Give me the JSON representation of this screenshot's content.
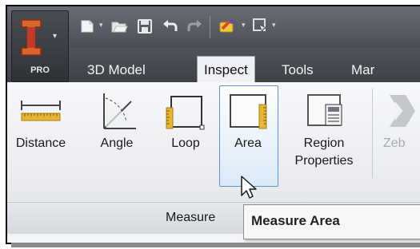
{
  "app": {
    "badge": "PRO"
  },
  "tabs": [
    {
      "label": "3D Model"
    },
    {
      "label": "Inspect",
      "active": true
    },
    {
      "label": "Tools"
    },
    {
      "label": "Mar"
    }
  ],
  "tools": [
    {
      "label": "Distance",
      "icon": "distance-icon"
    },
    {
      "label": "Angle",
      "icon": "angle-icon"
    },
    {
      "label": "Loop",
      "icon": "loop-icon"
    },
    {
      "label": "Area",
      "icon": "area-icon",
      "highlighted": true
    },
    {
      "label_line1": "Region",
      "label_line2": "Properties",
      "icon": "region-properties-icon"
    },
    {
      "label": "Zeb",
      "icon": "zebra-icon",
      "disabled": true
    }
  ],
  "panel": {
    "label": "Measure"
  },
  "tooltip": {
    "text": "Measure Area"
  },
  "colors": {
    "accent_ruler": "#e8b632",
    "highlight_border": "#5d95d1",
    "app_red": "#c0392b"
  }
}
